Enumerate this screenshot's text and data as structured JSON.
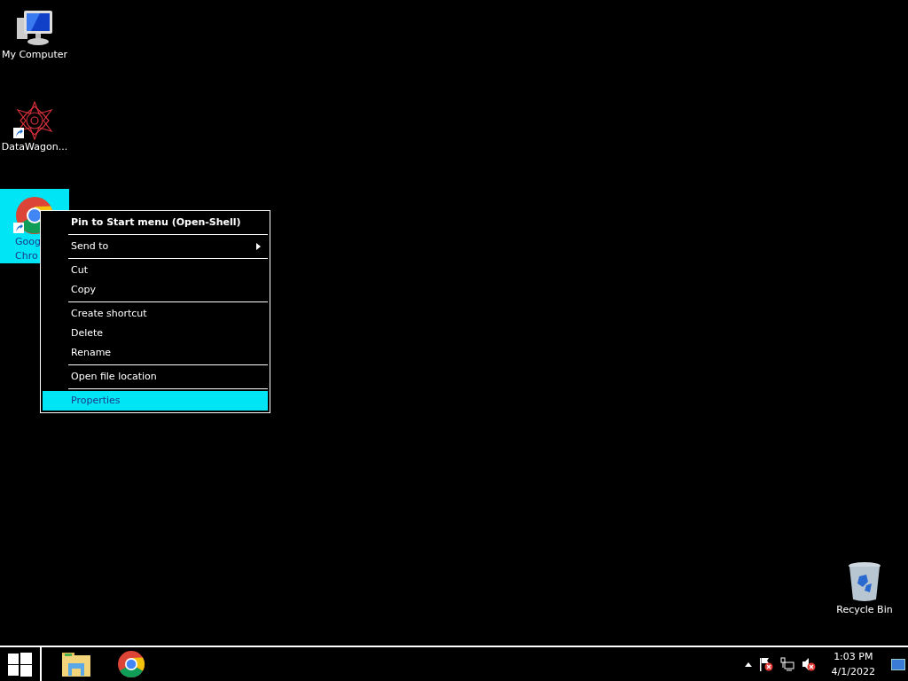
{
  "desktop_icons": [
    {
      "kind": "computer",
      "lines": [
        "My Computer"
      ],
      "shortcut": false,
      "selected": false
    },
    {
      "kind": "star",
      "lines": [
        "DataWagon..."
      ],
      "shortcut": true,
      "selected": false
    },
    {
      "kind": "chrome",
      "lines": [
        "Goog",
        "Chro"
      ],
      "shortcut": true,
      "selected": true
    },
    {
      "kind": "recycle",
      "lines": [
        "Recycle Bin"
      ],
      "shortcut": false,
      "selected": false
    }
  ],
  "context_menu": {
    "groups": [
      [
        {
          "label": "Pin to Start menu (Open-Shell)",
          "default": true,
          "submenu": false,
          "selected": false
        }
      ],
      [
        {
          "label": "Send to",
          "default": false,
          "submenu": true,
          "selected": false
        }
      ],
      [
        {
          "label": "Cut",
          "default": false,
          "submenu": false,
          "selected": false
        },
        {
          "label": "Copy",
          "default": false,
          "submenu": false,
          "selected": false
        }
      ],
      [
        {
          "label": "Create shortcut",
          "default": false,
          "submenu": false,
          "selected": false
        },
        {
          "label": "Delete",
          "default": false,
          "submenu": false,
          "selected": false
        },
        {
          "label": "Rename",
          "default": false,
          "submenu": false,
          "selected": false
        }
      ],
      [
        {
          "label": "Open file location",
          "default": false,
          "submenu": false,
          "selected": false
        }
      ],
      [
        {
          "label": "Properties",
          "default": false,
          "submenu": false,
          "selected": true
        }
      ]
    ]
  },
  "taskbar": {
    "pinned": [
      {
        "kind": "explorer"
      },
      {
        "kind": "chrome"
      }
    ],
    "tray": [
      {
        "kind": "caret"
      },
      {
        "kind": "flag"
      },
      {
        "kind": "network"
      },
      {
        "kind": "volume"
      }
    ],
    "clock": {
      "time": "1:03 PM",
      "date": "4/1/2022"
    }
  }
}
